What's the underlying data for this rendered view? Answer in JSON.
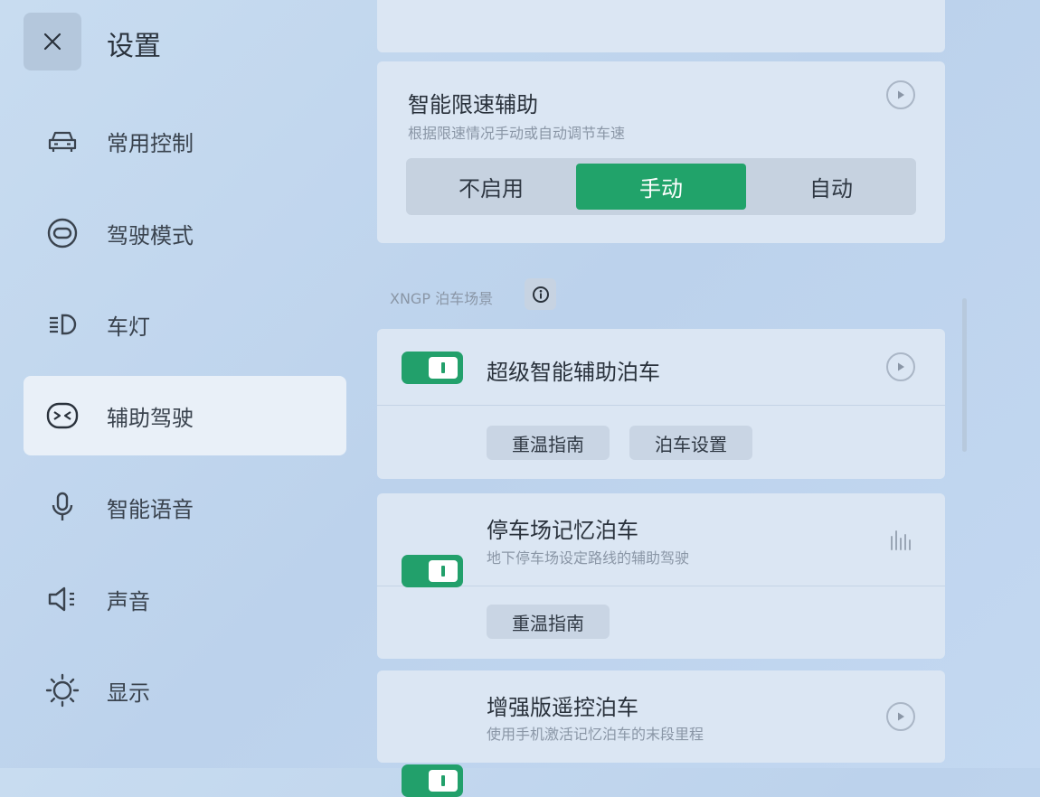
{
  "header": {
    "title": "设置"
  },
  "sidebar": {
    "items": [
      {
        "label": "常用控制",
        "icon": "car-icon"
      },
      {
        "label": "驾驶模式",
        "icon": "steering-wheel-icon"
      },
      {
        "label": "车灯",
        "icon": "headlight-icon"
      },
      {
        "label": "辅助驾驶",
        "icon": "assist-drive-icon",
        "active": true
      },
      {
        "label": "智能语音",
        "icon": "microphone-icon"
      },
      {
        "label": "声音",
        "icon": "speaker-icon"
      },
      {
        "label": "显示",
        "icon": "brightness-icon"
      }
    ]
  },
  "speed_limit": {
    "title": "智能限速辅助",
    "subtitle": "根据限速情况手动或自动调节车速",
    "options": [
      "不启用",
      "手动",
      "自动"
    ],
    "selected": "手动"
  },
  "section": {
    "label": "XNGP 泊车场景"
  },
  "features": [
    {
      "title": "超级智能辅助泊车",
      "subtitle": "",
      "enabled": true,
      "buttons": [
        "重温指南",
        "泊车设置"
      ],
      "trailing_icon": "play-icon"
    },
    {
      "title": "停车场记忆泊车",
      "subtitle": "地下停车场设定路线的辅助驾驶",
      "enabled": true,
      "buttons": [
        "重温指南"
      ],
      "trailing_icon": "bars-icon"
    },
    {
      "title": "增强版遥控泊车",
      "subtitle": "使用手机激活记忆泊车的末段里程",
      "enabled": true,
      "buttons": [],
      "trailing_icon": "play-icon"
    }
  ],
  "colors": {
    "accent": "#21a36a",
    "background": "#c3d8f1",
    "card": "#dbe6f3"
  }
}
